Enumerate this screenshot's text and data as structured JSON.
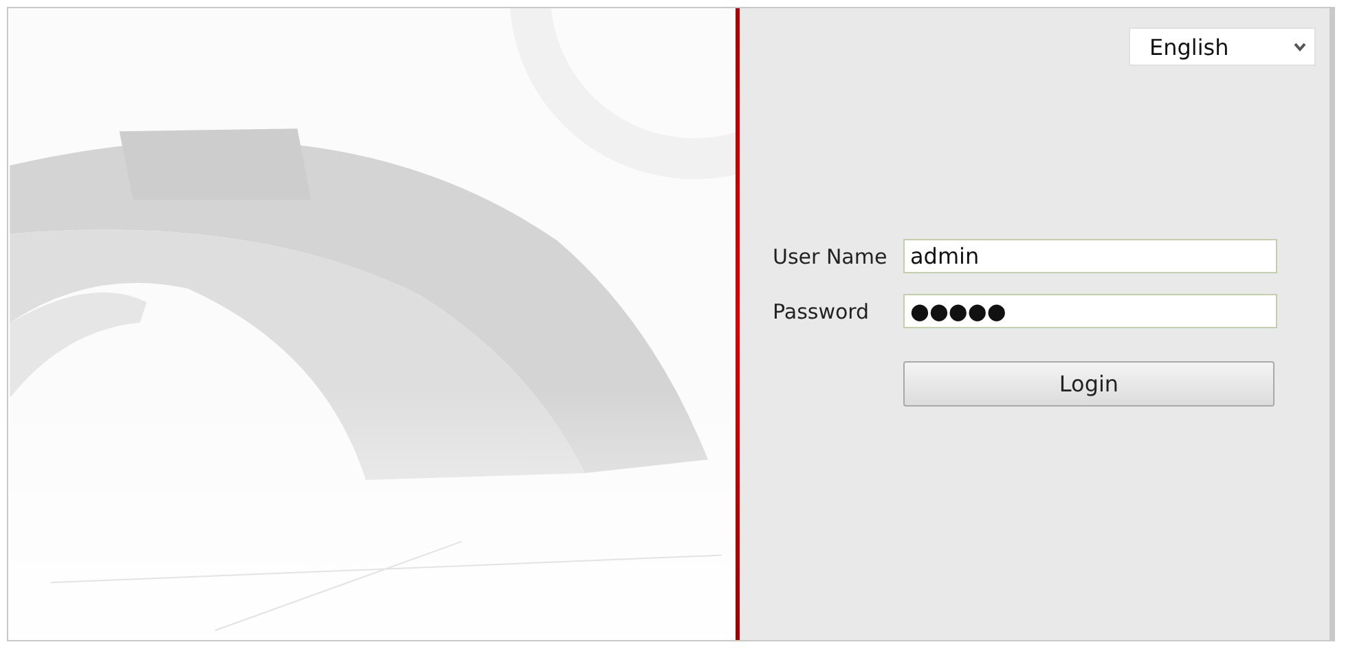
{
  "language_select": {
    "value": "English"
  },
  "login_form": {
    "fields": [
      {
        "label": "User Name",
        "value": "admin"
      },
      {
        "label": "Password",
        "value": "●●●●●"
      }
    ],
    "button": "Login"
  }
}
